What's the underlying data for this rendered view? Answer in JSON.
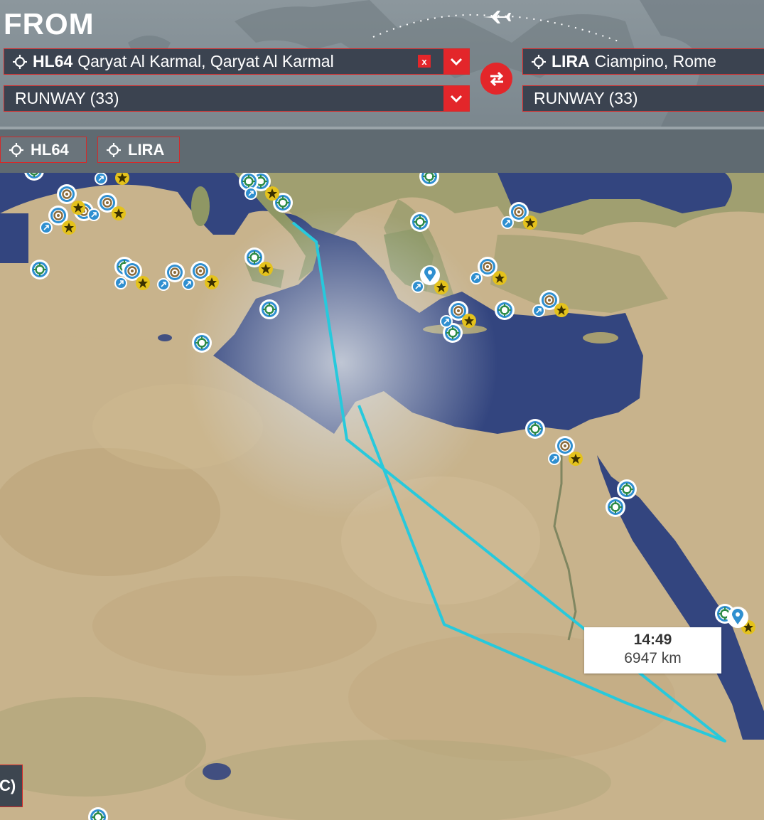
{
  "header": {
    "title": "FROM",
    "departure": {
      "icao": "HL64",
      "name": "Qaryat Al Karmal, Qaryat Al Karmal",
      "runway": "RUNWAY (33)",
      "clear_label": "x"
    },
    "arrival": {
      "icao": "LIRA",
      "name": "Ciampino, Rome",
      "runway": "RUNWAY (33)"
    }
  },
  "quick_chips": [
    {
      "label": "HL64"
    },
    {
      "label": "LIRA"
    }
  ],
  "flight_info": {
    "time": "14:49",
    "distance": "6947 km"
  },
  "corner_button_label": "C)",
  "colors": {
    "accent": "#e3262a",
    "route": "#27c9dc",
    "field_bg": "#3b4350",
    "sea": "#33457f",
    "land": "#c9b48c"
  }
}
